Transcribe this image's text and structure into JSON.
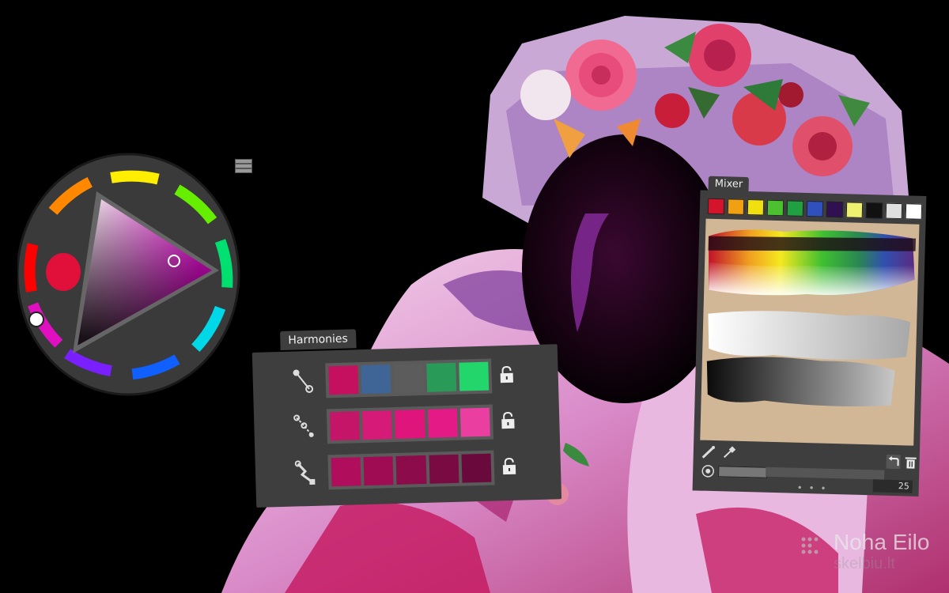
{
  "wheel": {
    "selected_color": "#e0087a",
    "hue_marker_color": "#e0103a",
    "menu_icon": "hamburger-menu-icon"
  },
  "harmonies": {
    "title": "Harmonies",
    "rows": [
      {
        "icon": "complementary-icon",
        "swatches": [
          "#c5105f",
          "#3f6596",
          "#5c5c5c",
          "#2a9a58",
          "#22d66c"
        ],
        "lock_icon": "lock-icon"
      },
      {
        "icon": "analogous-icon",
        "swatches": [
          "#c51568",
          "#d61a77",
          "#e0157b",
          "#e41a86",
          "#ea3ea0"
        ],
        "lock_icon": "lock-icon"
      },
      {
        "icon": "shades-icon",
        "swatches": [
          "#b00d5c",
          "#a00c53",
          "#8c0b4a",
          "#7a0a42",
          "#6a093b"
        ],
        "lock_icon": "lock-icon"
      }
    ]
  },
  "mixer": {
    "title": "Mixer",
    "swatches": [
      "#d4142a",
      "#f0a010",
      "#f0e010",
      "#4cc030",
      "#20a040",
      "#3050c0",
      "#301050",
      "#eef070",
      "#111111",
      "#e0e0e0",
      "#ffffff"
    ],
    "tools": {
      "dropper": "eyedropper-icon",
      "mix": "mixing-brush-icon",
      "undo": "undo-icon",
      "clear": "trash-icon"
    },
    "brush_size": "25",
    "more": "• • •"
  },
  "watermark": {
    "name": "Noha Eilo",
    "site": "skelbiu.lt"
  }
}
